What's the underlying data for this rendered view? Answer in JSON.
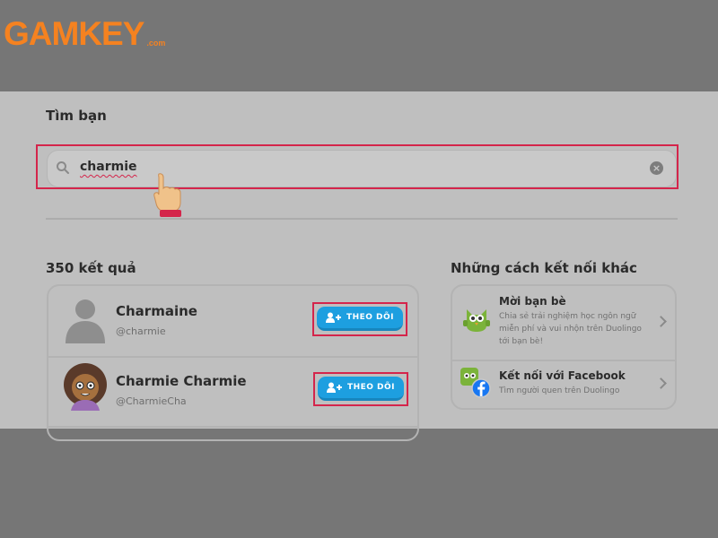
{
  "logo": {
    "text": "GAMKEY",
    "domain": ".com"
  },
  "page": {
    "title": "Tìm bạn"
  },
  "search": {
    "value": "charmie",
    "icon": "search-icon"
  },
  "results": {
    "count_label": "350 kết quả",
    "items": [
      {
        "name": "Charmaine",
        "username": "@charmie",
        "follow_label": "THEO DÕI"
      },
      {
        "name": "Charmie Charmie",
        "username": "@CharmieCha",
        "follow_label": "THEO DÕI"
      }
    ]
  },
  "other": {
    "title": "Những cách kết nối khác",
    "options": [
      {
        "title": "Mời bạn bè",
        "description_line1": "Chia sẻ trải nghiệm học ngôn ngữ",
        "description_line2": "miễn phí và vui nhộn trên Duolingo",
        "description_line3": "tới bạn bè!"
      },
      {
        "title": "Kết nối với Facebook",
        "description_line1": "Tìm người quen trên Duolingo"
      }
    ]
  },
  "colors": {
    "accent": "#1d9fe0",
    "highlight": "#d4254b",
    "logo": "#f58220",
    "backdrop": "#767676",
    "panel": "#bfbfbf"
  }
}
